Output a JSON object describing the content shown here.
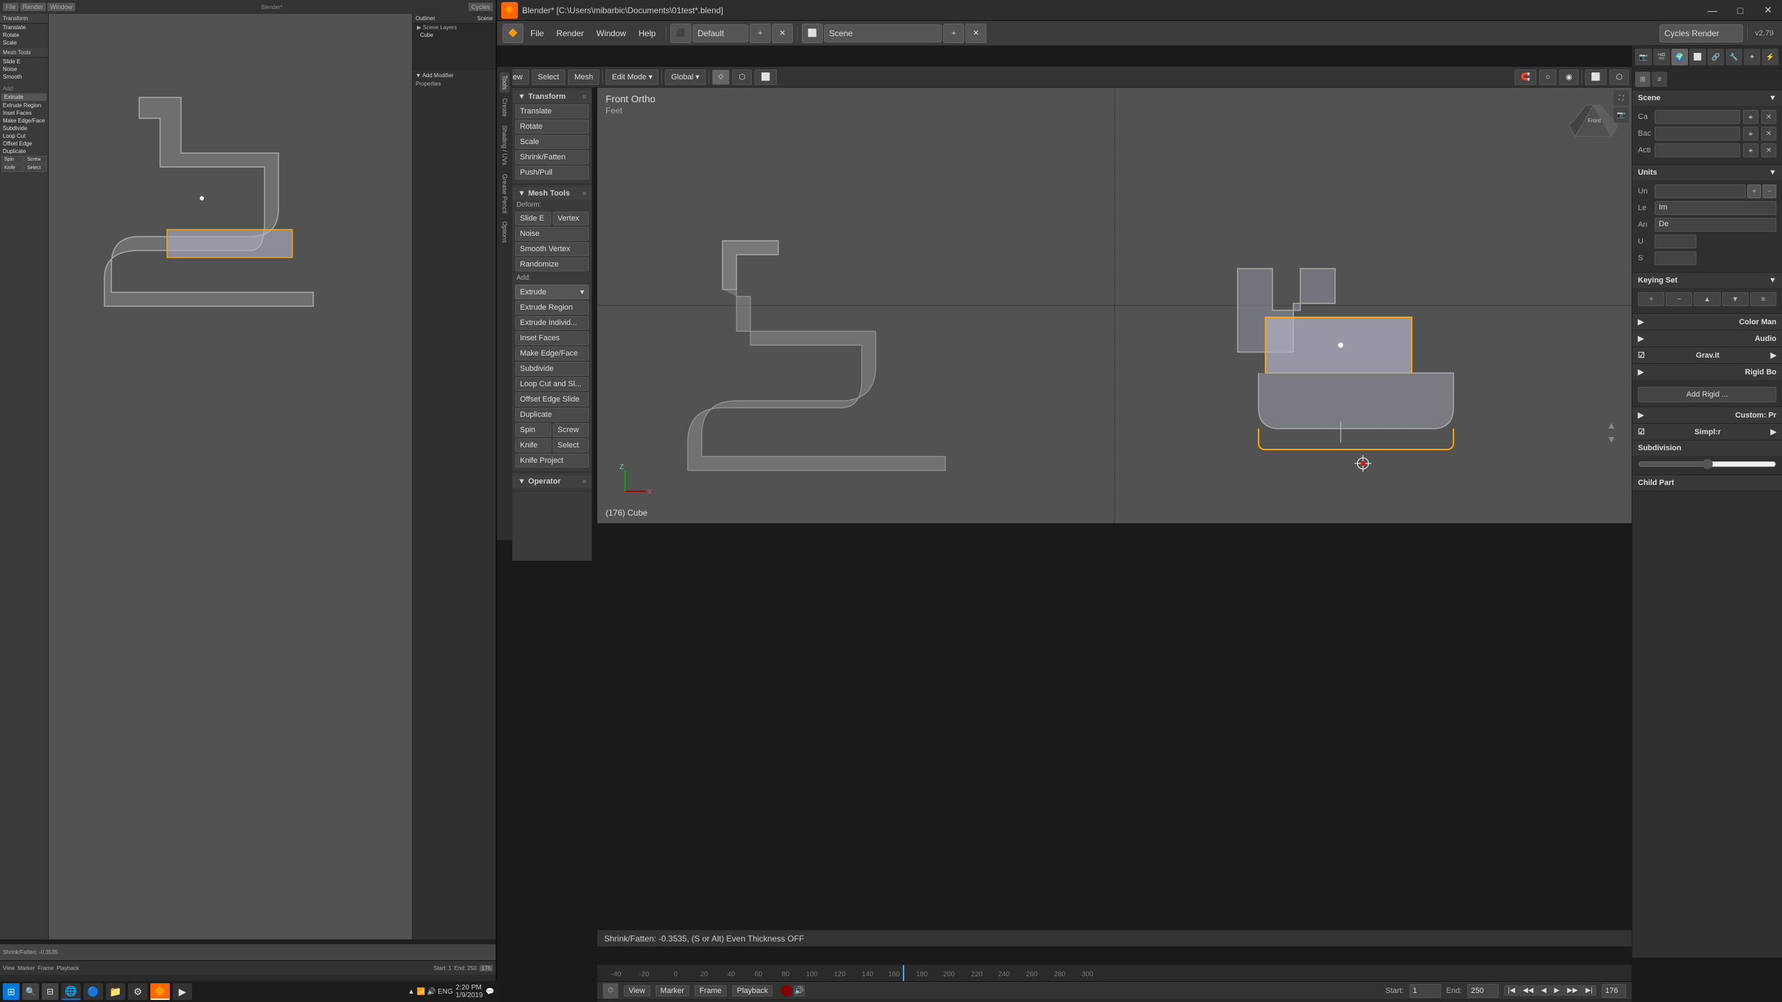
{
  "window": {
    "title": "Blender* [C:\\Users\\mibarbic\\Documents\\01test*.blend]",
    "icon": "🔶"
  },
  "titlebar": {
    "minimize": "—",
    "maximize": "□",
    "close": "✕"
  },
  "menubar": {
    "file": "File",
    "render": "Render",
    "window": "Window",
    "help": "Help",
    "default_layout": "Default",
    "scene": "Scene",
    "engine": "Cycles Render",
    "version": "v2.79"
  },
  "viewport": {
    "label": "Front Ortho",
    "units": "Feet",
    "object_info": "(176) Cube",
    "status": "Shrink/Fatten: -0.3535, (S or Alt) Even Thickness OFF"
  },
  "tools_sidebar": {
    "sections": [
      {
        "name": "Transform",
        "items": [
          "Translate",
          "Rotate",
          "Scale",
          "Shrink/Fatten",
          "Push/Pull"
        ]
      },
      {
        "name": "Mesh Tools",
        "deform_label": "Deform:",
        "items_row1": [
          "Slide E",
          "Vertex"
        ],
        "items": [
          "Noise",
          "Smooth Vertex",
          "Randomize"
        ],
        "add_label": "Add:",
        "extrude": "Extrude",
        "add_items": [
          "Extrude Region",
          "Extrude Individ...",
          "Inset Faces",
          "Make Edge/Face",
          "Subdivide",
          "Loop Cut and Sl...",
          "Offset Edge Slide",
          "Duplicate"
        ],
        "row_items1": [
          "Spin",
          "Screw"
        ],
        "row_items2": [
          "Knife",
          "Select"
        ],
        "last_item": "Knife Project"
      }
    ],
    "operator_label": "Operator"
  },
  "right_panel": {
    "scene_label": "Scene",
    "camera_short": "Ca",
    "background_short": "Bac",
    "active_short": "Acti",
    "sections": [
      {
        "name": "Units",
        "rows": [
          {
            "label": "Un",
            "value": ""
          },
          {
            "label": "Le",
            "value": "Im"
          },
          {
            "label": "An",
            "value": "De"
          },
          {
            "label": "U",
            "value": ""
          }
        ]
      },
      {
        "name": "Keying Set",
        "add_btn": "Add Rigid ..."
      },
      {
        "name": "Color Man"
      },
      {
        "name": "Audio"
      },
      {
        "name": "Grav.it"
      },
      {
        "name": "Rigid Bo"
      },
      {
        "name": "Custom: Pr"
      },
      {
        "name": "Simpl:r"
      },
      {
        "name": "Subdivision"
      },
      {
        "name": "Child Part"
      }
    ]
  },
  "timeline": {
    "view_btn": "View",
    "marker_btn": "Marker",
    "frame_btn": "Frame",
    "playback_btn": "Playback",
    "start_label": "Start:",
    "start_value": "1",
    "end_label": "End:",
    "end_value": "250",
    "current_frame": "176"
  },
  "icons": {
    "triangle": "▶",
    "arrow_down": "▼",
    "arrow_right": "▶",
    "plus": "+",
    "minus": "−",
    "link": "🔗",
    "camera": "📷",
    "mesh": "⬡",
    "scene": "🎬",
    "render": "🖼",
    "world": "🌍",
    "object": "⬜",
    "constraint": "🔗",
    "modifier": "🔧",
    "particles": "✦",
    "physics": "⚡",
    "material": "◉"
  }
}
